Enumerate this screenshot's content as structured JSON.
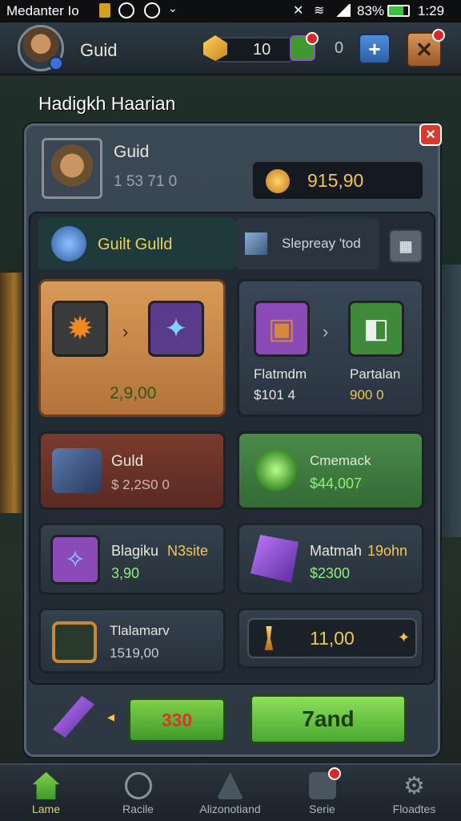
{
  "status": {
    "carrier": "Medanter Io",
    "battery": "83%",
    "time": "1:29"
  },
  "top": {
    "res1_value": "10",
    "res2_value": "0",
    "plus": "+",
    "close_x": "✕"
  },
  "player_name": "Hadigkh Haarian",
  "panel": {
    "close": "✕",
    "header_title": "Guid",
    "header_sub": "1 53 71 0",
    "gold_value": "915,90",
    "tab_active": "Guilt Gulld",
    "tab_other": "Slepreay 'tod"
  },
  "cards": {
    "upgrade_price": "2,9,00",
    "flatmdm_name": "Flatmdm",
    "flatmdm_price": "$101 4",
    "partalan_name": "Partalan",
    "partalan_price": "900 0",
    "guld_name": "Guld",
    "guld_price": "$ 2,2S0 0",
    "cmemack_name": "Cmemack",
    "cmemack_price": "$44,007",
    "blagiku_name": "Blagiku",
    "blagiku_tag": "N3site",
    "blagiku_price": "3,90",
    "matmah_name": "Matmah",
    "matmah_tag": "19ohn",
    "matmah_price": "$2300",
    "tlalamarv_name": "Tlalamarv",
    "tlalamarv_price": "1519,00",
    "gold_slider_value": "11,00"
  },
  "bottom": {
    "small_btn": "330",
    "big_btn": "7and"
  },
  "nav": [
    "Lame",
    "Racile",
    "Alizonotiand",
    "Serie",
    "Floadtes"
  ],
  "colors": {
    "accent_green": "#5fb838",
    "accent_orange": "#c8873f",
    "accent_red": "#7a3a2e",
    "gold": "#f4c64a"
  }
}
